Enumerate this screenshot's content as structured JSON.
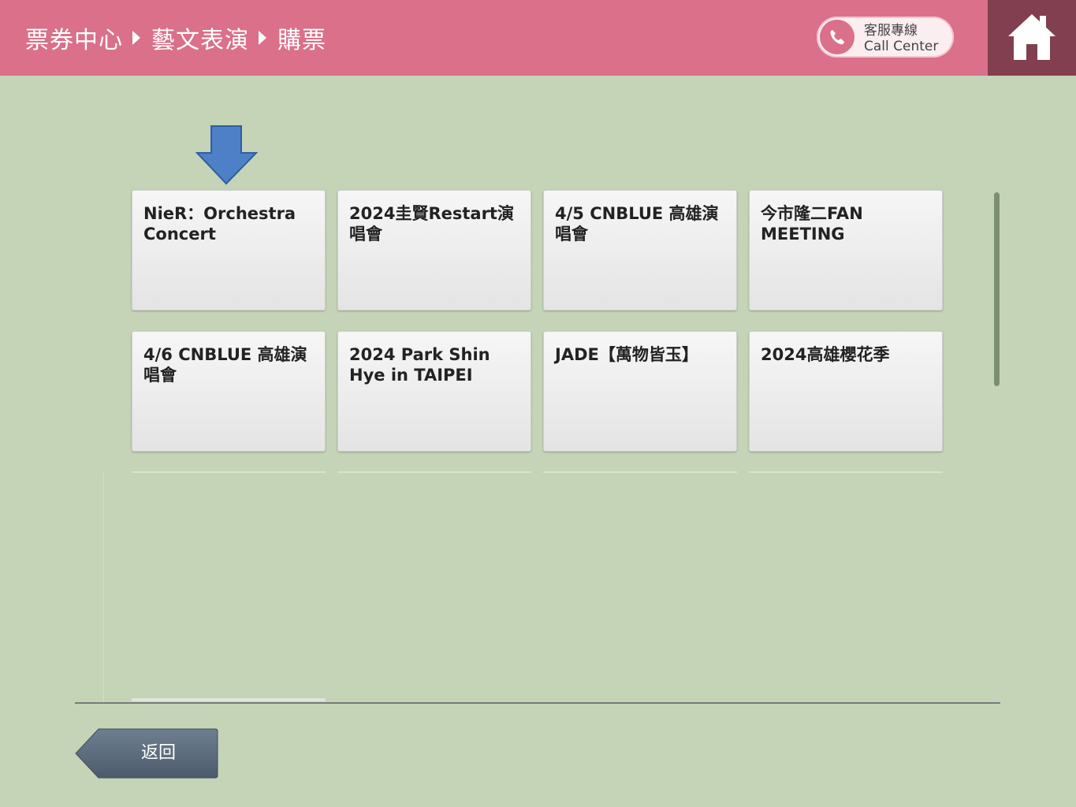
{
  "header": {
    "breadcrumb": [
      "票券中心",
      "藝文表演",
      "購票"
    ],
    "call_center": {
      "label_zh": "客服專線",
      "label_en": "Call Center"
    },
    "colors": {
      "header_bg": "#da7089",
      "home_bg": "#813f4f"
    }
  },
  "events": [
    {
      "title": "NieR：Orchestra Concert"
    },
    {
      "title": "2024圭賢Restart演唱會"
    },
    {
      "title": "4/5 CNBLUE 高雄演唱會"
    },
    {
      "title": "今市隆二FAN MEETING"
    },
    {
      "title": "4/6 CNBLUE 高雄演唱會"
    },
    {
      "title": "2024 Park Shin Hye in TAIPEI"
    },
    {
      "title": "JADE【萬物皆玉】"
    },
    {
      "title": "2024高雄櫻花季"
    }
  ],
  "footer": {
    "back_label": "返回"
  },
  "icons": {
    "call": "phone-icon",
    "home": "home-icon",
    "pointer": "down-arrow-icon"
  }
}
